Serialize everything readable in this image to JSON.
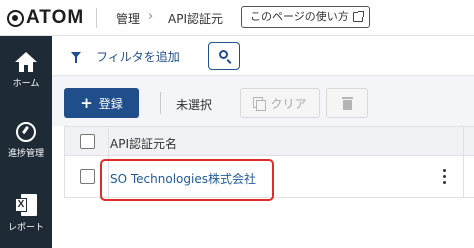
{
  "header": {
    "logo_text": "ATOM",
    "breadcrumb": [
      "管理",
      "API認証元"
    ],
    "help_button": "このページの使い方"
  },
  "sidebar": {
    "items": [
      {
        "label": "ホーム",
        "icon": "home-icon"
      },
      {
        "label": "進捗管理",
        "icon": "progress-icon"
      },
      {
        "label": "レポート",
        "icon": "report-icon"
      }
    ]
  },
  "filter": {
    "add_filter_label": "フィルタを追加"
  },
  "actions": {
    "add_label": "登録",
    "selection_status": "未選択",
    "clear_label": "クリア"
  },
  "table": {
    "column_header": "API認証元名",
    "rows": [
      {
        "name": "SO Technologies株式会社"
      }
    ]
  },
  "colors": {
    "sidebar_bg": "#1f2a37",
    "accent": "#1f4e8a",
    "highlight": "#e02b2b"
  }
}
